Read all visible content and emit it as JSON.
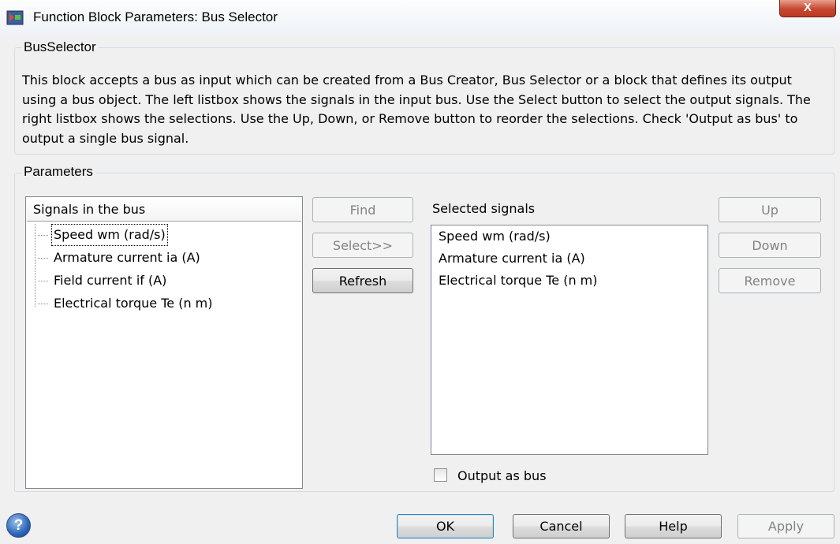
{
  "window": {
    "title": "Function Block Parameters: Bus Selector",
    "app_icon": "simulink-block-icon",
    "close_glyph": "X"
  },
  "block_group": {
    "label": "BusSelector",
    "description": "This block accepts a bus as input which can be created from a Bus Creator, Bus Selector or a block that defines its output using a bus object. The left listbox shows the signals in the input bus. Use the Select button to select the output signals. The right listbox shows the selections. Use the Up, Down, or Remove button to reorder the selections. Check 'Output as bus' to output a single bus signal."
  },
  "parameters": {
    "label": "Parameters",
    "signals_in_bus": {
      "header": "Signals in the bus",
      "items": [
        "Speed wm (rad/s)",
        "Armature current ia (A)",
        "Field current if (A)",
        "Electrical torque Te (n m)"
      ],
      "selected_index": 0
    },
    "middle_buttons": {
      "find": "Find",
      "select": "Select>>",
      "refresh": "Refresh"
    },
    "selected_signals": {
      "label": "Selected signals",
      "items": [
        "Speed wm (rad/s)",
        "Armature current ia (A)",
        "Electrical torque Te (n m)"
      ]
    },
    "reorder_buttons": {
      "up": "Up",
      "down": "Down",
      "remove": "Remove"
    },
    "output_as_bus": {
      "label": "Output as bus",
      "checked": false
    }
  },
  "footer": {
    "help_icon": "?",
    "ok": "OK",
    "cancel": "Cancel",
    "help": "Help",
    "apply": "Apply"
  }
}
